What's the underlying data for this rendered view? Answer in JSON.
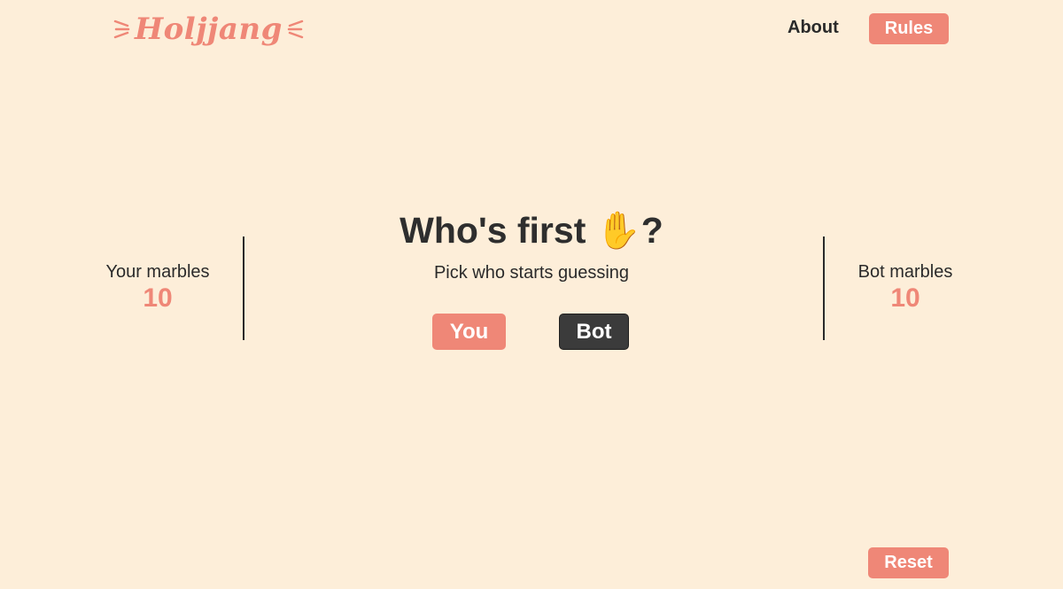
{
  "header": {
    "logo_text": "Holjjang",
    "nav": {
      "about": "About",
      "rules": "Rules"
    }
  },
  "players": {
    "you": {
      "label": "Your marbles",
      "count": "10"
    },
    "bot": {
      "label": "Bot marbles",
      "count": "10"
    }
  },
  "main": {
    "title_text": "Who's first ",
    "title_emoji": "✋",
    "title_suffix": "?",
    "subtitle": "Pick who starts guessing",
    "choices": {
      "you": "You",
      "bot": "Bot"
    }
  },
  "footer": {
    "reset": "Reset"
  },
  "icons": {
    "logo_burst": "burst-lines-icon",
    "hand": "raised-hand-emoji"
  },
  "colors": {
    "background": "#fdeed9",
    "accent": "#ef8777",
    "dark_button": "#3b3b3b",
    "text": "#2e2e2e"
  }
}
